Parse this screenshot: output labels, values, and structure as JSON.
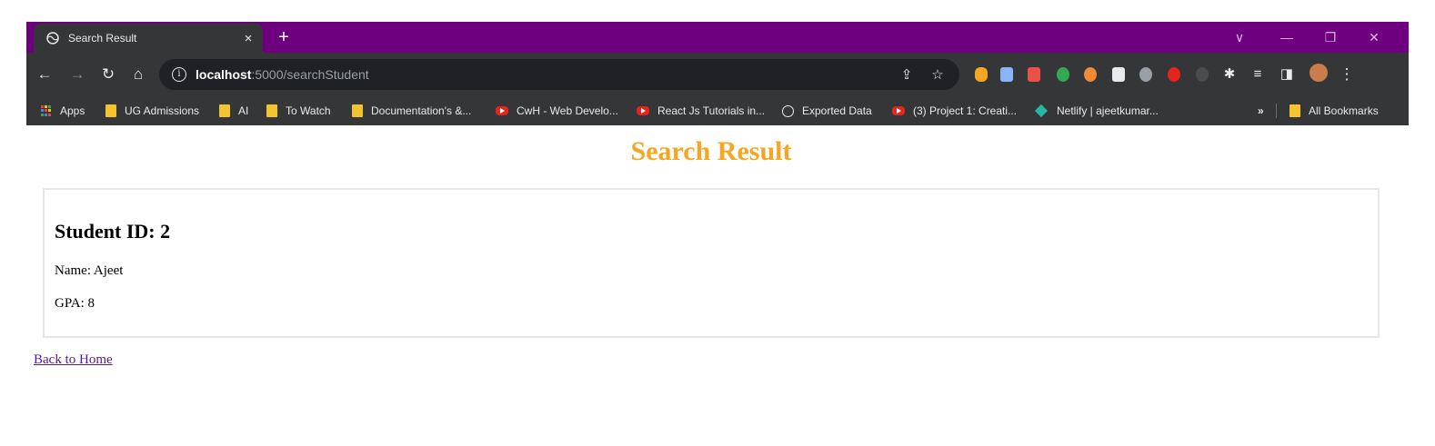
{
  "browser": {
    "tab": {
      "title": "Search Result",
      "close": "×"
    },
    "new_tab": "+",
    "window_controls": {
      "dropdown": "∨",
      "minimize": "—",
      "restore": "❐",
      "close": "✕"
    },
    "address": {
      "host": "localhost",
      "path": ":5000/searchStudent"
    },
    "bookmarks": [
      {
        "label": "Apps",
        "icon": "apps-grid-icon"
      },
      {
        "label": "UG Admissions",
        "icon": "folder-icon"
      },
      {
        "label": "AI",
        "icon": "folder-icon"
      },
      {
        "label": "To Watch",
        "icon": "folder-icon"
      },
      {
        "label": "Documentation's &...",
        "icon": "folder-icon"
      },
      {
        "label": "CwH - Web Develo...",
        "icon": "youtube-icon"
      },
      {
        "label": "React Js Tutorials in...",
        "icon": "youtube-icon"
      },
      {
        "label": "Exported Data",
        "icon": "globe-icon"
      },
      {
        "label": "(3) Project 1: Creati...",
        "icon": "youtube-icon"
      },
      {
        "label": "Netlify | ajeetkumar...",
        "icon": "netlify-icon"
      }
    ],
    "bookmarks_overflow": "»",
    "all_bookmarks": "All Bookmarks"
  },
  "page": {
    "title": "Search Result",
    "student_heading": "Student ID: 2",
    "name_line": "Name: Ajeet",
    "gpa_line": "GPA: 8",
    "back_link": "Back to Home"
  },
  "colors": {
    "tabstrip": "#6e0080",
    "toolbar": "#353638",
    "title_accent": "#f5a623",
    "visited_link": "#551a8b"
  }
}
